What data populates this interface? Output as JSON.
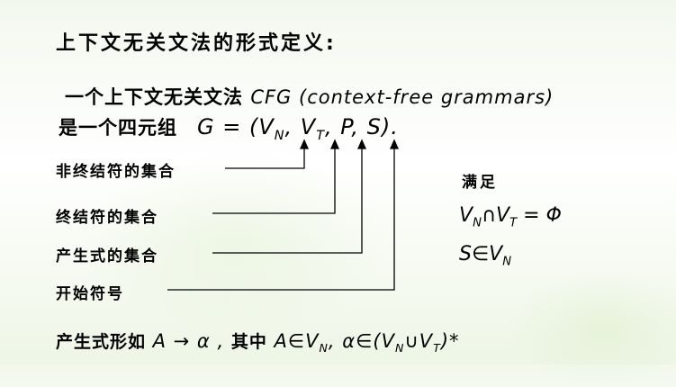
{
  "title": "上下文无关文法的形式定义:",
  "definition": {
    "prefix": "一个上下文无关文法 ",
    "term": "CFG (context-free grammars)",
    "line2_prefix": "是一个四元组",
    "tuple": "G = (V<sub>N</sub>, V<sub>T</sub>, P, S)."
  },
  "labels": {
    "nonterminals": "非终结符的集合",
    "terminals": "终结符的集合",
    "productions": "产生式的集合",
    "start": "开始符号"
  },
  "satisfies": {
    "title": "满足",
    "cond1": "V<sub>N</sub>∩V<sub>T</sub> = Φ",
    "cond2": "S∈V<sub>N</sub>"
  },
  "production_form": {
    "prefix": "产生式形如 ",
    "formula": "A → α , ",
    "where": "其中 ",
    "constraint": "A∈V<sub>N</sub>, α∈(V<sub>N</sub>∪V<sub>T</sub>)*"
  }
}
